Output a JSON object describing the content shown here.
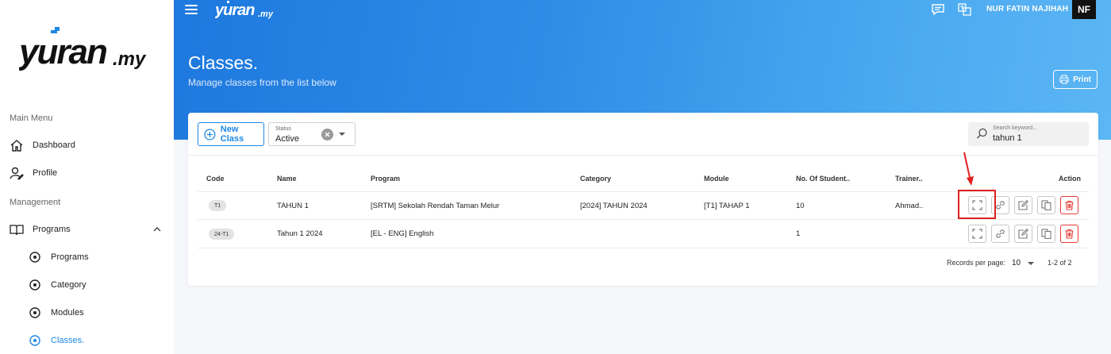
{
  "brand": {
    "logo_text": "yuran.my",
    "accent": "#1e88e5"
  },
  "sidebar": {
    "section_main": "Main Menu",
    "section_management": "Management",
    "items": [
      {
        "label": "Dashboard",
        "icon": "home-icon"
      },
      {
        "label": "Profile",
        "icon": "profile-icon"
      },
      {
        "label": "Programs",
        "icon": "book-icon"
      },
      {
        "label": "Programs",
        "icon": "radio-icon"
      },
      {
        "label": "Category",
        "icon": "radio-icon"
      },
      {
        "label": "Modules",
        "icon": "radio-icon"
      },
      {
        "label": "Classes.",
        "icon": "radio-icon",
        "active": true
      }
    ]
  },
  "header": {
    "user_name": "NUR FATIN NAJIHAH",
    "avatar_initials": "NF",
    "title": "Classes.",
    "subtitle": "Manage classes from the list below",
    "print_label": "Print"
  },
  "toolbar": {
    "new_class_label": "New Class",
    "status_caption": "Status",
    "status_value": "Active",
    "search_placeholder": "Search keyword...",
    "search_value": "tahun 1"
  },
  "table": {
    "columns": [
      "Code",
      "Name",
      "Program",
      "Category",
      "Module",
      "No. Of Student..",
      "Trainer..",
      "Action"
    ],
    "rows": [
      {
        "code": "T1",
        "name": "TAHUN 1",
        "program": "[SRTM] Sekolah Rendah Taman Melur",
        "category": "[2024] TAHUN 2024",
        "module": "[T1] TAHAP 1",
        "students": "10",
        "trainer": "Ahmad.."
      },
      {
        "code": "24-T1",
        "name": "Tahun 1 2024",
        "program": "[EL - ENG] English",
        "category": "",
        "module": "",
        "students": "1",
        "trainer": ""
      }
    ]
  },
  "pagination": {
    "records_label": "Records per page:",
    "per_page": "10",
    "range": "1-2 of 2"
  }
}
